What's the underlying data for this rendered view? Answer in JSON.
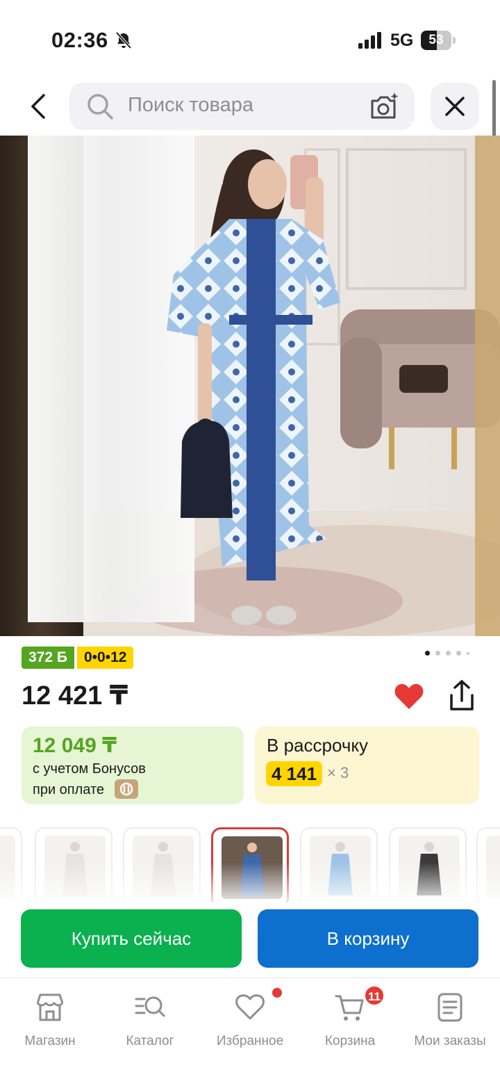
{
  "status_bar": {
    "time": "02:36",
    "network": "5G",
    "battery_level": "53",
    "battery_fraction": 0.53
  },
  "search": {
    "placeholder": "Поиск товара"
  },
  "icons": {
    "back": "chevron-left-icon",
    "search": "search-icon",
    "camera": "camera-sparkle-icon",
    "close": "close-icon",
    "favorite": "heart-icon",
    "share": "share-icon"
  },
  "product": {
    "bonus_points": "372 Б",
    "installment_badge": "0•0•12",
    "price": "12 421 ₸",
    "photo_count": 5,
    "active_photo_index": 0,
    "favorite_color": "#e53935"
  },
  "bonus_card": {
    "price": "12 049 ₸",
    "line1": "с учетом Бонусов",
    "line2": "при оплате"
  },
  "installment_card": {
    "title": "В рассрочку",
    "amount": "4 141",
    "multiplier": "× 3"
  },
  "thumbnails": {
    "count": 7,
    "selected_index": 3
  },
  "actions": {
    "buy_now": "Купить сейчас",
    "add_to_cart": "В корзину"
  },
  "bottom_nav": {
    "items": [
      {
        "label": "Магазин",
        "icon": "store-icon"
      },
      {
        "label": "Каталог",
        "icon": "catalog-search-icon"
      },
      {
        "label": "Избранное",
        "icon": "heart-outline-icon"
      },
      {
        "label": "Корзина",
        "icon": "cart-icon",
        "count": "11"
      },
      {
        "label": "Мои заказы",
        "icon": "orders-icon"
      }
    ]
  },
  "colors": {
    "buy_button": "#0ab14e",
    "cart_button": "#0d6fce",
    "bonus_green": "#54a51f",
    "promo_yellow": "#ffd500",
    "badge_red": "#e53935"
  }
}
